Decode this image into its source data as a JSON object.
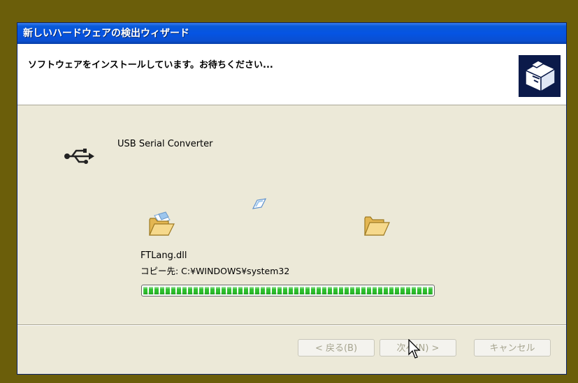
{
  "window": {
    "title": "新しいハードウェアの検出ウィザード"
  },
  "header": {
    "message": "ソフトウェアをインストールしています。お待ちください...",
    "icon": "hardware-install-icon"
  },
  "device": {
    "icon": "usb-icon",
    "name": "USB Serial Converter"
  },
  "copy": {
    "source_icon": "folder-open-icon",
    "flying_icon": "paper-icon",
    "dest_icon": "folder-open-icon",
    "file_name": "FTLang.dll",
    "destination": "コピー先: C:¥WINDOWS¥system32",
    "progress": 1.0,
    "progress_color": "#2ec02e"
  },
  "buttons": {
    "back": "< 戻る(B)",
    "next": "次へ(N) >",
    "cancel": "キャンセル"
  },
  "colors": {
    "title_bar": "#0554e3",
    "window_bg": "#ece9d8",
    "desktop": "#6b5e0a"
  }
}
